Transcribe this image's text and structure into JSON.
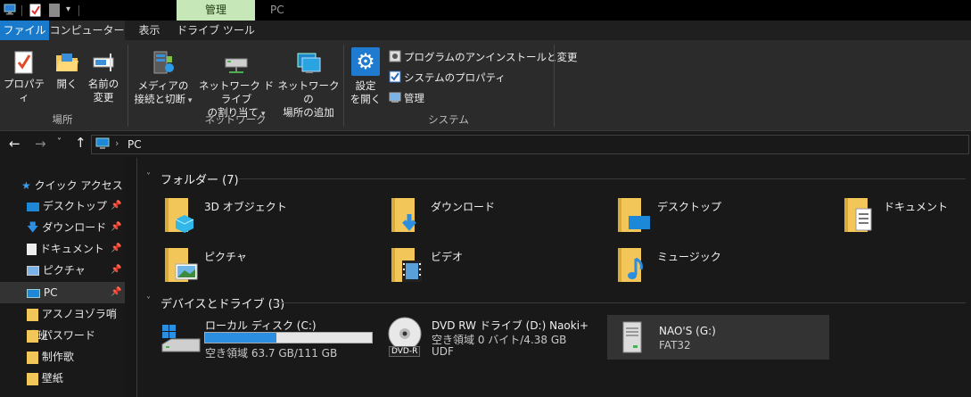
{
  "title_bar": {
    "manage_tab": "管理",
    "window_title": "PC"
  },
  "ribbon_tabs": {
    "file": "ファイル",
    "computer": "コンピューター",
    "view": "表示",
    "drive_tools": "ドライブ ツール"
  },
  "ribbon": {
    "location": {
      "properties": "プロパティ",
      "open": "開く",
      "rename_1": "名前の",
      "rename_2": "変更",
      "group": "場所"
    },
    "network": {
      "media_1": "メディアの",
      "media_2": "接続と切断",
      "map_1": "ネットワーク ドライブ",
      "map_2": "の割り当て",
      "addloc_1": "ネットワークの",
      "addloc_2": "場所の追加",
      "group": "ネットワーク"
    },
    "system": {
      "settings_1": "設定",
      "settings_2": "を開く",
      "uninstall": "プログラムのアンインストールと変更",
      "sysprops": "システムのプロパティ",
      "manage": "管理",
      "group": "システム"
    }
  },
  "address": {
    "path": "PC"
  },
  "sidebar": {
    "quick_access": "クイック アクセス",
    "items": [
      "デスクトップ",
      "ダウンロード",
      "ドキュメント",
      "ピクチャ",
      "PC",
      "アスノヨゾラ哨戒班",
      "パスワード",
      "制作歌",
      "壁紙"
    ]
  },
  "folders": {
    "header": "フォルダー (7)",
    "items": [
      "3D オブジェクト",
      "ダウンロード",
      "デスクトップ",
      "ドキュメント",
      "ピクチャ",
      "ビデオ",
      "ミュージック"
    ]
  },
  "drives": {
    "header": "デバイスとドライブ (3)",
    "c": {
      "name": "ローカル ディスク (C:)",
      "free": "空き領域 63.7 GB/111 GB",
      "used_fraction": 0.43
    },
    "d": {
      "name": "DVD RW ドライブ (D:) Naoki+",
      "free": "空き領域 0 バイト/4.38 GB",
      "fs": "UDF",
      "badge": "DVD-R"
    },
    "g": {
      "name": "NAO'S (G:)",
      "fs": "FAT32"
    }
  },
  "colors": {
    "accent": "#1979ca",
    "manage": "#c6e8b8",
    "folder": "#f3c65a",
    "bar": "#2b8ee0"
  }
}
